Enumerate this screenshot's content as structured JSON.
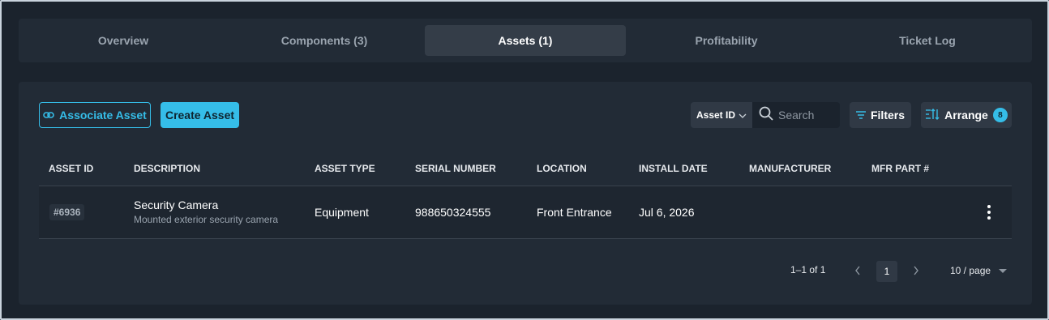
{
  "tabs": [
    {
      "label": "Overview",
      "active": false
    },
    {
      "label": "Components (3)",
      "active": false
    },
    {
      "label": "Assets (1)",
      "active": true
    },
    {
      "label": "Profitability",
      "active": false
    },
    {
      "label": "Ticket Log",
      "active": false
    }
  ],
  "toolbar": {
    "associate_label": "Associate Asset",
    "associate_icon": "link-icon",
    "create_label": "Create Asset",
    "search_field": "Asset ID",
    "search_placeholder": "Search",
    "filters_label": "Filters",
    "arrange_label": "Arrange",
    "arrange_count": "8"
  },
  "table": {
    "columns": [
      "ASSET ID",
      "DESCRIPTION",
      "ASSET TYPE",
      "SERIAL NUMBER",
      "LOCATION",
      "INSTALL DATE",
      "MANUFACTURER",
      "MFR PART #"
    ],
    "rows": [
      {
        "asset_id": "#6936",
        "description": "Security Camera",
        "description_sub": "Mounted exterior security camera",
        "asset_type": "Equipment",
        "serial_number": "988650324555",
        "location": "Front Entrance",
        "install_date": "Jul 6, 2026",
        "manufacturer": "",
        "mfr_part": ""
      }
    ]
  },
  "pagination": {
    "range": "1–1 of 1",
    "current_page": "1",
    "per_page": "10 / page"
  },
  "colors": {
    "accent": "#35bde8",
    "background": "#1b232d",
    "panel": "#222b36"
  }
}
